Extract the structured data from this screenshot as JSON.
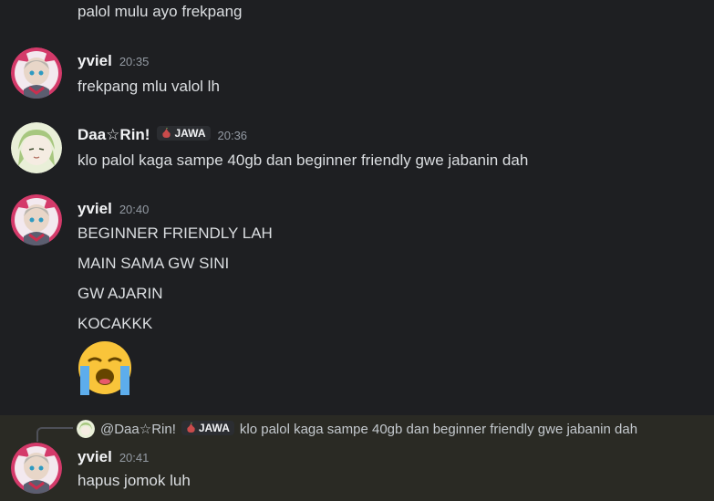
{
  "messages": {
    "m0": {
      "text": "palol mulu ayo frekpang"
    },
    "m1": {
      "username": "yviel",
      "time": "20:35",
      "text": "frekpang mlu valol lh"
    },
    "m2": {
      "username": "Daa☆Rin!",
      "tag": "JAWA",
      "time": "20:36",
      "text": "klo palol kaga sampe 40gb dan beginner friendly gwe jabanin dah"
    },
    "m3": {
      "username": "yviel",
      "time": "20:40",
      "lines": [
        "BEGINNER FRIENDLY LAH",
        "MAIN SAMA GW SINI",
        "GW AJARIN",
        "KOCAKKK"
      ],
      "emoji": "loudly-crying-face"
    },
    "m4": {
      "reply": {
        "mention": "@Daa☆Rin!",
        "tag": "JAWA",
        "text": "klo palol kaga sampe 40gb dan beginner friendly gwe jabanin dah"
      },
      "username": "yviel",
      "time": "20:41",
      "text": "hapus jomok luh"
    }
  },
  "colors": {
    "background": "#1e1f22",
    "highlight": "#2a2a24",
    "username": "#f2f3f5",
    "timestamp": "#949ba4",
    "text": "#dbdee1"
  }
}
